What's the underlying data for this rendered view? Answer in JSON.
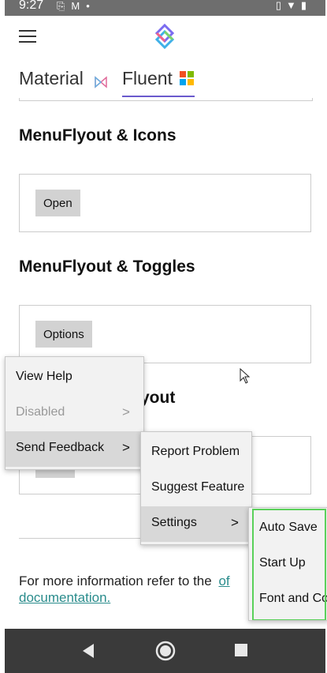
{
  "status": {
    "time": "9:27"
  },
  "tabs": [
    {
      "label": "Material"
    },
    {
      "label": "Fluent"
    }
  ],
  "sections": {
    "icons": {
      "title": "MenuFlyout & Icons",
      "button": "Open"
    },
    "toggles": {
      "title": "MenuFlyout & Toggles",
      "button": "Options"
    },
    "hidden_title_fragment": "yout"
  },
  "info": {
    "text": "For more information refer to the",
    "link1": "of",
    "link2": "documentation."
  },
  "menu1": {
    "items": [
      {
        "label": "View Help"
      },
      {
        "label": "Disabled",
        "disabled": true
      },
      {
        "label": "Send Feedback",
        "selected": true
      }
    ]
  },
  "menu2": {
    "items": [
      {
        "label": "Report Problem"
      },
      {
        "label": "Suggest Feature"
      },
      {
        "label": "Settings",
        "selected": true
      }
    ]
  },
  "menu3": {
    "items": [
      {
        "label": "Auto Save"
      },
      {
        "label": "Start Up"
      },
      {
        "label": "Font and Co"
      }
    ],
    "highlight_color": "#5ad05a"
  },
  "colors": {
    "tab_indicator": "#6a5acd",
    "link": "#2a8c8c"
  }
}
